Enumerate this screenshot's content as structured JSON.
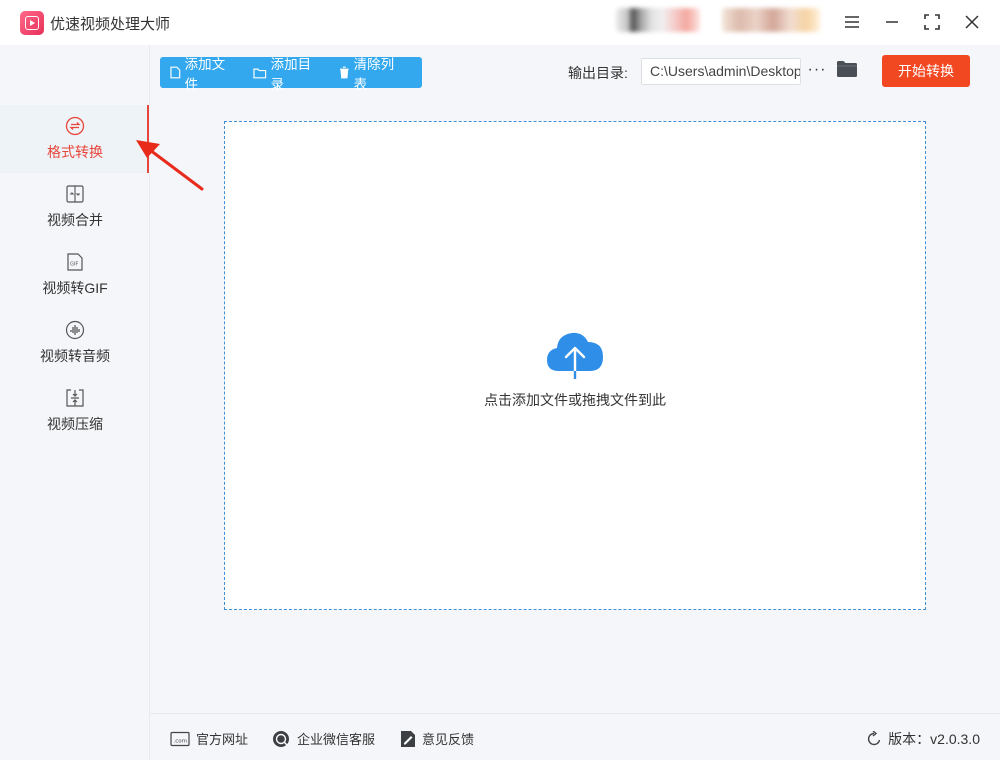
{
  "app": {
    "title": "优速视频处理大师"
  },
  "sidebar": {
    "items": [
      {
        "label": "格式转换",
        "icon": "format-convert-icon",
        "active": true
      },
      {
        "label": "视频合并",
        "icon": "video-merge-icon",
        "active": false
      },
      {
        "label": "视频转GIF",
        "icon": "gif-icon",
        "active": false
      },
      {
        "label": "视频转音频",
        "icon": "audio-icon",
        "active": false
      },
      {
        "label": "视频压缩",
        "icon": "compress-icon",
        "active": false
      }
    ]
  },
  "toolbar": {
    "add_file": "添加文件",
    "add_folder": "添加目录",
    "clear_list": "清除列表",
    "output_label": "输出目录:",
    "output_path": "C:\\Users\\admin\\Desktop",
    "more": "···",
    "start": "开始转换"
  },
  "dropzone": {
    "text": "点击添加文件或拖拽文件到此"
  },
  "footer": {
    "website": "官方网址",
    "wechat": "企业微信客服",
    "feedback": "意见反馈",
    "version": "版本：v2.0.3.0"
  },
  "colors": {
    "accent": "#33a8ee",
    "primary_action": "#f24822",
    "active": "#e8463a",
    "border_dashed": "#3f8fd7"
  }
}
